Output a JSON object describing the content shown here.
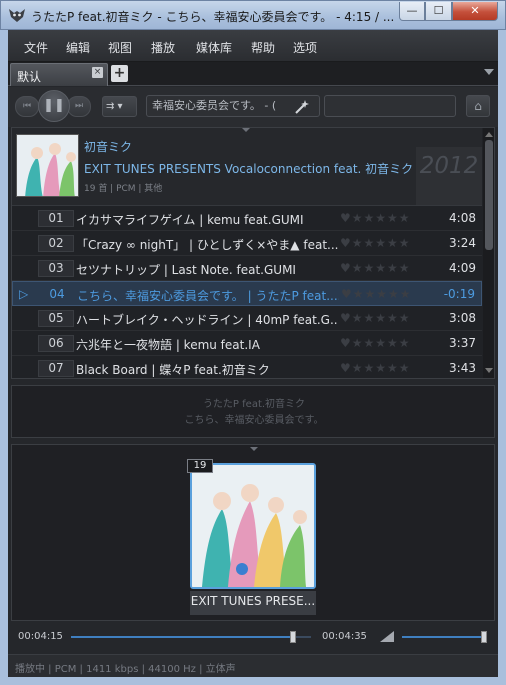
{
  "window": {
    "title": "うたたP feat.初音ミク - こちら、幸福安心委員会です。 - 4:15 / ...",
    "min_glyph": "—",
    "max_glyph": "☐",
    "close_glyph": "✕"
  },
  "menu": [
    "文件",
    "编辑",
    "视图",
    "播放",
    "媒体库",
    "帮助",
    "选项"
  ],
  "tabs": {
    "active": "默认",
    "close_glyph": "×",
    "add_glyph": "+"
  },
  "toolbar": {
    "prev_glyph": "⏮",
    "play_glyph": "❚❚",
    "next_glyph": "⏭",
    "order_glyph": "⇉ ▾",
    "search_value": "幸福安心委员会です。 - (",
    "search_icon": "search-magic-icon",
    "home_glyph": "⌂"
  },
  "album": {
    "artist": "初音ミク",
    "title": "EXIT TUNES PRESENTS Vocaloconnection feat. 初音ミク",
    "meta": "19 首 | PCM | 其他",
    "year": "2012"
  },
  "tracks": [
    {
      "num": "01",
      "title": "イカサマライフゲイム | kemu feat.GUMI",
      "duration": "4:08",
      "playing": false
    },
    {
      "num": "02",
      "title": "「Crazy ∞ nighT」 | ひとしずく×やま▲ feat....",
      "duration": "3:24",
      "playing": false
    },
    {
      "num": "03",
      "title": "セツナトリップ | Last Note. feat.GUMI",
      "duration": "4:09",
      "playing": false
    },
    {
      "num": "04",
      "title": "こちら、幸福安心委員会です。 | うたたP feat....",
      "duration": "-0:19",
      "playing": true
    },
    {
      "num": "05",
      "title": "ハートブレイク・ヘッドライン | 40mP feat.G...",
      "duration": "3:08",
      "playing": false
    },
    {
      "num": "06",
      "title": "六兆年と一夜物語 | kemu feat.IA",
      "duration": "3:37",
      "playing": false
    },
    {
      "num": "07",
      "title": "Black Board | 蝶々P feat.初音ミク",
      "duration": "3:43",
      "playing": false
    }
  ],
  "rating_glyphs": "♥★★★★★",
  "play_mark": "▷",
  "lyrics": {
    "line1": "うたたP feat.初音ミク",
    "line2": "こちら、幸福安心委員会です。"
  },
  "coverflow": {
    "count": "19",
    "label": "EXIT TUNES PRESE..."
  },
  "seek": {
    "current": "00:04:15",
    "total": "00:04:35",
    "progress": 0.927,
    "volume": 0.98
  },
  "status": "播放中 | PCM | 1411 kbps | 44100 Hz | 立体声",
  "colors": {
    "accent": "#4d9be0",
    "background": "#25272b",
    "titlebar": "#a9bfdc"
  }
}
